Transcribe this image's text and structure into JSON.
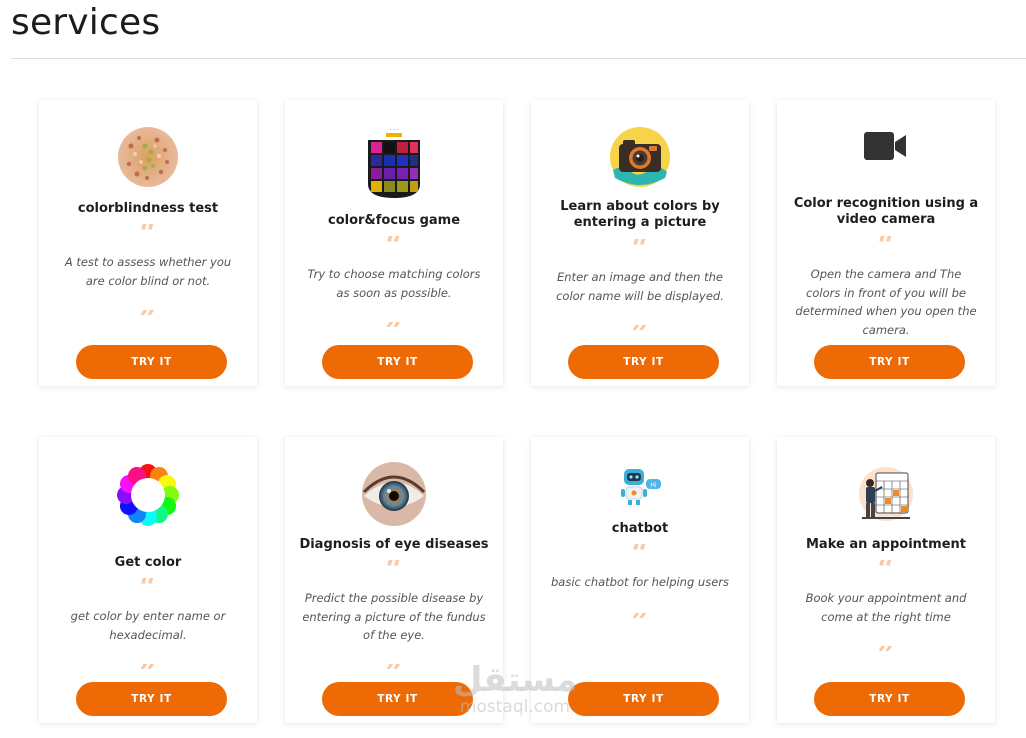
{
  "page": {
    "title": "services"
  },
  "quote_open": "“",
  "quote_close": "”",
  "cards": [
    {
      "title": "colorblindness test",
      "description": "A test to assess whether you are color blind or not.",
      "button": "TRY IT",
      "icon": "ishihara-plate-icon"
    },
    {
      "title": "color&focus game",
      "description": "Try to choose matching colors as soon as possible.",
      "button": "TRY IT",
      "icon": "color-grid-game-icon"
    },
    {
      "title": "Learn about colors by entering a picture",
      "description": "Enter an image and then the color name will be displayed.",
      "button": "TRY IT",
      "icon": "camera-icon"
    },
    {
      "title": "Color recognition using a video camera",
      "description": "Open the camera and The colors in front of you will be determined when you open the camera.",
      "button": "TRY IT",
      "icon": "video-camera-icon"
    },
    {
      "title": "Get color",
      "description": "get color by enter name or hexadecimal.",
      "button": "TRY IT",
      "icon": "color-wheel-icon"
    },
    {
      "title": "Diagnosis of eye diseases",
      "description": "Predict the possible disease by entering a picture of the fundus of the eye.",
      "button": "TRY IT",
      "icon": "eye-icon"
    },
    {
      "title": "chatbot",
      "description": "basic chatbot for helping users",
      "button": "TRY IT",
      "icon": "robot-icon"
    },
    {
      "title": "Make an appointment",
      "description": "Book your appointment and come at the right time",
      "button": "TRY IT",
      "icon": "calendar-appointment-icon"
    }
  ],
  "watermark": {
    "arabic": "مستقل",
    "latin": "mostaql.com"
  },
  "colors": {
    "accent": "#ee6a05",
    "quote": "#f9c9a6"
  }
}
